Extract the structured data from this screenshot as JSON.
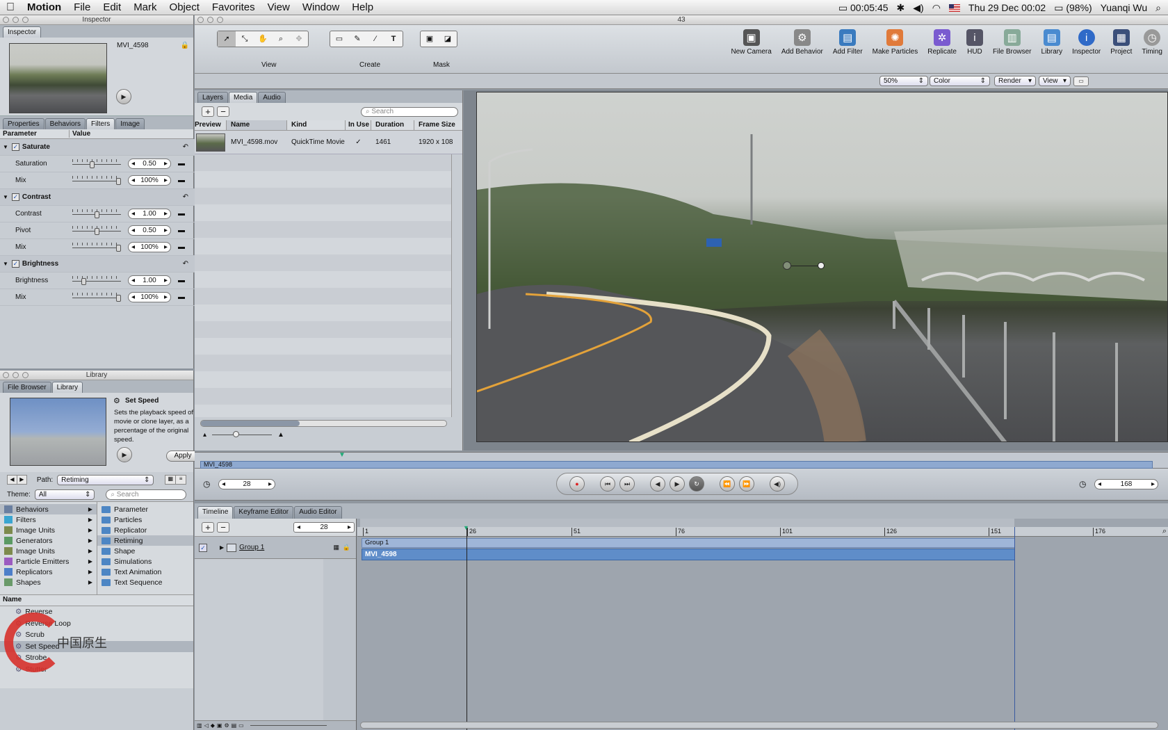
{
  "menubar": {
    "app": "Motion",
    "items": [
      "File",
      "Edit",
      "Mark",
      "Object",
      "Favorites",
      "View",
      "Window",
      "Help"
    ],
    "time": "00:05:45",
    "clock": "Thu 29 Dec  00:02",
    "battery": "(98%)",
    "user": "Yuanqi Wu"
  },
  "inspector": {
    "title": "Inspector",
    "tab": "Inspector",
    "clip_name": "MVI_4598",
    "tabs": [
      "Properties",
      "Behaviors",
      "Filters",
      "Image"
    ],
    "col_parameter": "Parameter",
    "col_value": "Value",
    "rows": [
      {
        "name": "Saturate",
        "header": true
      },
      {
        "name": "Saturation",
        "value": "0.50",
        "knob": 0.4
      },
      {
        "name": "Mix",
        "value": "100%",
        "knob": 1.0
      },
      {
        "name": "Contrast",
        "header": true
      },
      {
        "name": "Contrast",
        "value": "1.00",
        "knob": 0.5
      },
      {
        "name": "Pivot",
        "value": "0.50",
        "knob": 0.5
      },
      {
        "name": "Mix",
        "value": "100%",
        "knob": 1.0
      },
      {
        "name": "Brightness",
        "header": true
      },
      {
        "name": "Brightness",
        "value": "1.00",
        "knob": 0.2
      },
      {
        "name": "Mix",
        "value": "100%",
        "knob": 1.0
      }
    ]
  },
  "library": {
    "title": "Library",
    "tabs": [
      "File Browser",
      "Library"
    ],
    "item_title": "Set Speed",
    "item_desc": "Sets the playback speed of a movie or clone layer, as a percentage of the original speed.",
    "apply": "Apply",
    "path_label": "Path:",
    "path_value": "Retiming",
    "theme_label": "Theme:",
    "theme_value": "All",
    "search_placeholder": "Search",
    "categories": [
      "Behaviors",
      "Filters",
      "Image Units",
      "Generators",
      "Image Units",
      "Particle Emitters",
      "Replicators",
      "Shapes"
    ],
    "subfolders": [
      "Parameter",
      "Particles",
      "Replicator",
      "Retiming",
      "Shape",
      "Simulations",
      "Text Animation",
      "Text Sequence"
    ],
    "name_header": "Name",
    "items": [
      "Reverse",
      "Reverse Loop",
      "Scrub",
      "Set Speed",
      "Strobe",
      "Stutter"
    ]
  },
  "toolbar": {
    "doc_title": "43",
    "groups": [
      "View",
      "Create",
      "Mask"
    ],
    "buttons": [
      "New Camera",
      "Add Behavior",
      "Add Filter",
      "Make Particles",
      "Replicate",
      "HUD",
      "File Browser",
      "Library",
      "Inspector",
      "Project",
      "Timing"
    ],
    "zoom": "50%",
    "color": "Color",
    "render": "Render",
    "view": "View"
  },
  "project": {
    "tabs": [
      "Layers",
      "Media",
      "Audio"
    ],
    "search_placeholder": "Search",
    "columns": [
      "Preview",
      "Name",
      "Kind",
      "In Use",
      "Duration",
      "Frame Size"
    ],
    "row": {
      "name": "MVI_4598.mov",
      "kind": "QuickTime Movie",
      "in_use": "✓",
      "duration": "1461",
      "frame_size": "1920 x 108"
    }
  },
  "minitimeline": {
    "clip": "MVI_4598"
  },
  "transport": {
    "frame": "28",
    "end_frame": "168"
  },
  "timeline": {
    "tabs": [
      "Timeline",
      "Keyframe Editor",
      "Audio Editor"
    ],
    "frame": "28",
    "group": "Group 1",
    "layer": "MVI_4598",
    "ruler": [
      "1",
      "26",
      "51",
      "76",
      "101",
      "126",
      "151",
      "176"
    ]
  },
  "watermark": "中国原生"
}
